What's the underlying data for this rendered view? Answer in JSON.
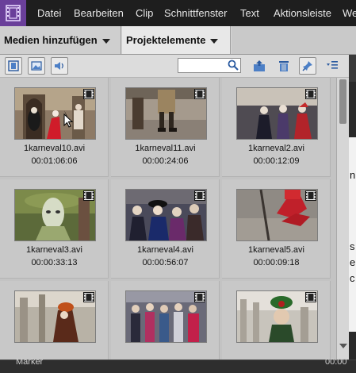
{
  "menubar": {
    "items": [
      "Datei",
      "Bearbeiten",
      "Clip",
      "Schnittfenster",
      "Text",
      "Aktionsleiste",
      "We"
    ]
  },
  "tabs": {
    "media": "Medien hinzufügen",
    "project": "Projektelemente"
  },
  "search": {
    "value": ""
  },
  "side_panel": {
    "letters": [
      "n",
      "s",
      "e",
      "c"
    ]
  },
  "bottom": {
    "label": "Marker",
    "timecode": "00:00"
  },
  "clips": [
    {
      "name": "1karneval10.avi",
      "duration": "00:01:06:06"
    },
    {
      "name": "1karneval11.avi",
      "duration": "00:00:24:06"
    },
    {
      "name": "1karneval2.avi",
      "duration": "00:00:12:09"
    },
    {
      "name": "1karneval3.avi",
      "duration": "00:00:33:13"
    },
    {
      "name": "1karneval4.avi",
      "duration": "00:00:56:07"
    },
    {
      "name": "1karneval5.avi",
      "duration": "00:00:09:18"
    },
    {
      "name": "",
      "duration": ""
    },
    {
      "name": "",
      "duration": ""
    },
    {
      "name": "",
      "duration": ""
    }
  ]
}
